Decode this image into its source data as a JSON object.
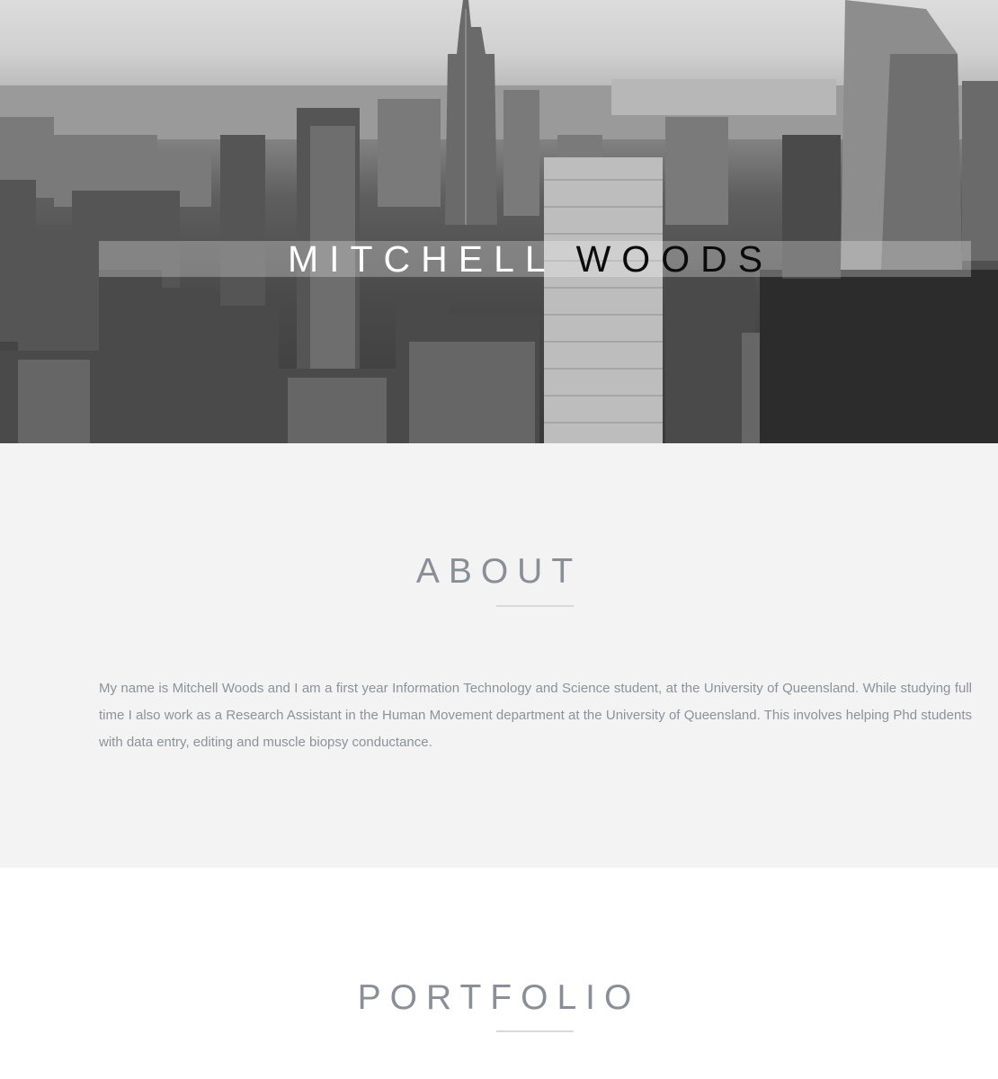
{
  "hero": {
    "first_name": "MITCHELL",
    "last_name": "WOODS",
    "image_description": "black-and-white city skyline"
  },
  "about": {
    "heading": "ABOUT",
    "body": "My name is Mitchell Woods and I am a first year Information Technology and Science student, at the University of Queensland. While studying full time I also work as a Research Assistant in the Human Movement department at the University of Queensland. This involves helping Phd students with data entry, editing and muscle biopsy conductance."
  },
  "portfolio": {
    "heading": "PORTFOLIO"
  },
  "colors": {
    "about_background": "#f3f3f4",
    "heading_text": "#8a8f97",
    "body_text": "#8c929a",
    "rule": "#d8d9db"
  }
}
